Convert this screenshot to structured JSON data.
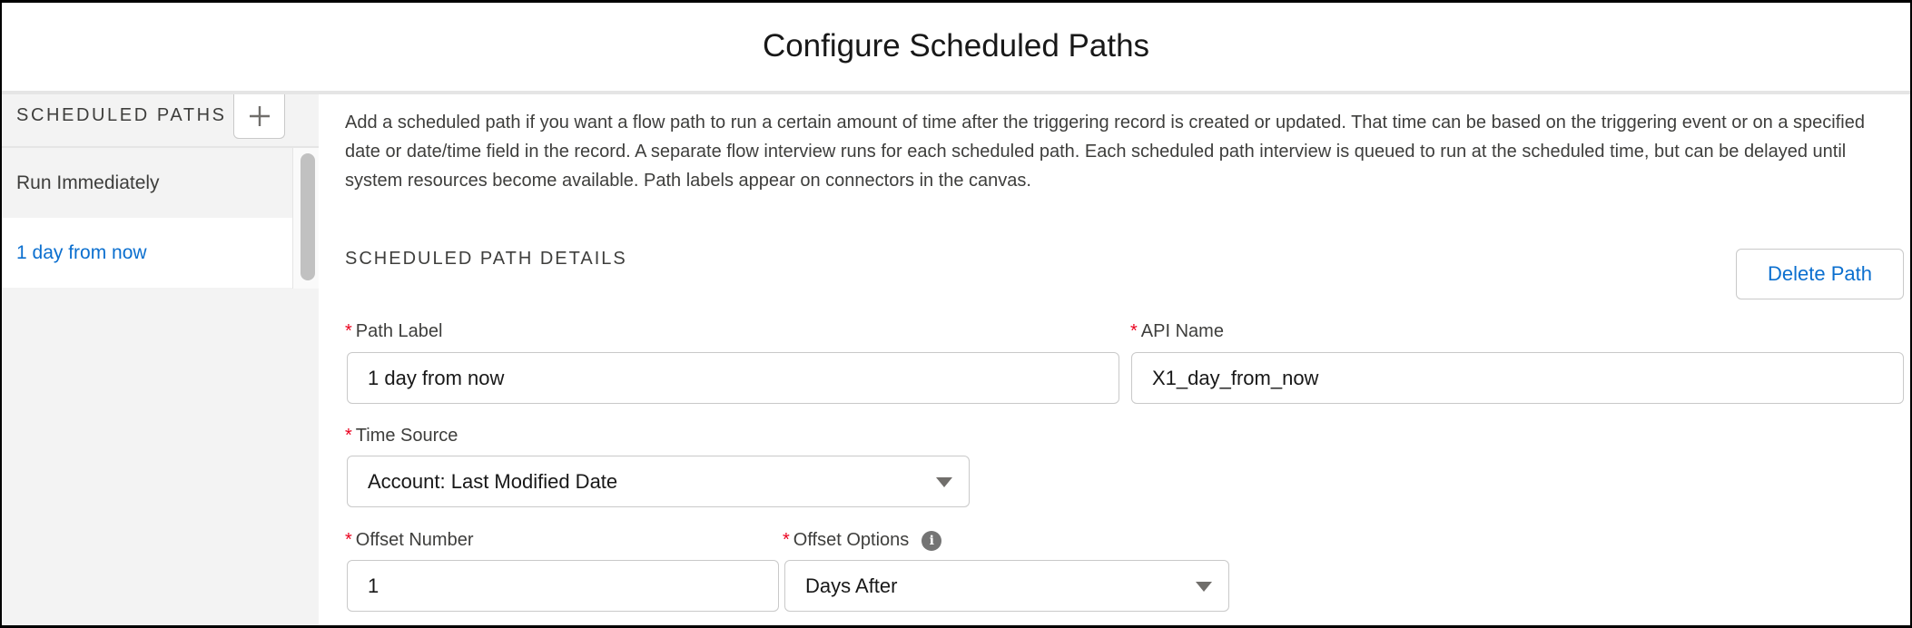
{
  "dialog": {
    "title": "Configure Scheduled Paths"
  },
  "sidebar": {
    "heading": "SCHEDULED PATHS",
    "add_button_icon": "plus-icon",
    "items": [
      {
        "label": "Run Immediately",
        "selected": false
      },
      {
        "label": "1 day from now",
        "selected": true
      }
    ]
  },
  "main": {
    "description": "Add a scheduled path if you want a flow path to run a certain amount of time after the triggering record is created or updated. That time can be based on the triggering event or on a specified date or date/time field in the record. A separate flow interview runs for each scheduled path. Each scheduled path interview is queued to run at the scheduled time, but can be delayed until system resources become available. Path labels appear on connectors in the canvas.",
    "section_title": "SCHEDULED PATH DETAILS",
    "delete_button": "Delete Path",
    "fields": {
      "path_label": {
        "label": "Path Label",
        "required": "*",
        "value": "1 day from now"
      },
      "api_name": {
        "label": "API Name",
        "required": "*",
        "value": "X1_day_from_now"
      },
      "time_source": {
        "label": "Time Source",
        "required": "*",
        "value": "Account: Last Modified Date"
      },
      "offset_number": {
        "label": "Offset Number",
        "required": "*",
        "value": "1"
      },
      "offset_options": {
        "label": "Offset Options",
        "required": "*",
        "value": "Days After",
        "info_icon": "i"
      }
    }
  },
  "colors": {
    "accent_link": "#0b6fcf",
    "required_asterisk": "#ea001e",
    "sidebar_bg": "#f3f3f3",
    "text": "#3e3e3c"
  }
}
